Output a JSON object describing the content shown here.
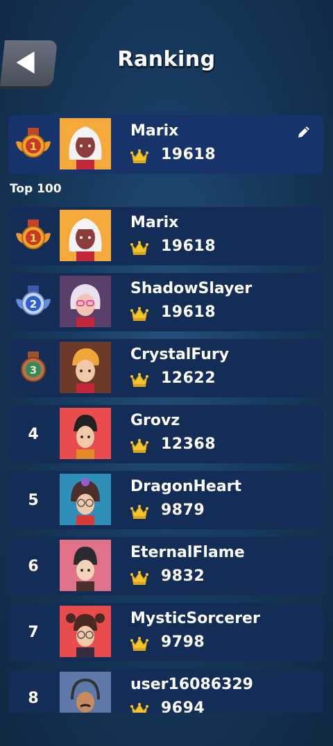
{
  "header": {
    "title": "Ranking"
  },
  "my_entry": {
    "rank": "1",
    "name": "Marix",
    "score": "19618"
  },
  "section_label": "Top 100",
  "players": [
    {
      "rank": "1",
      "name": "Marix",
      "score": "19618"
    },
    {
      "rank": "2",
      "name": "ShadowSlayer",
      "score": "19618"
    },
    {
      "rank": "3",
      "name": "CrystalFury",
      "score": "12622"
    },
    {
      "rank": "4",
      "name": "Grovz",
      "score": "12368"
    },
    {
      "rank": "5",
      "name": "DragonHeart",
      "score": "9879"
    },
    {
      "rank": "6",
      "name": "EternalFlame",
      "score": "9832"
    },
    {
      "rank": "7",
      "name": "MysticSorcerer",
      "score": "9798"
    },
    {
      "rank": "8",
      "name": "user16086329",
      "score": "9694"
    }
  ]
}
